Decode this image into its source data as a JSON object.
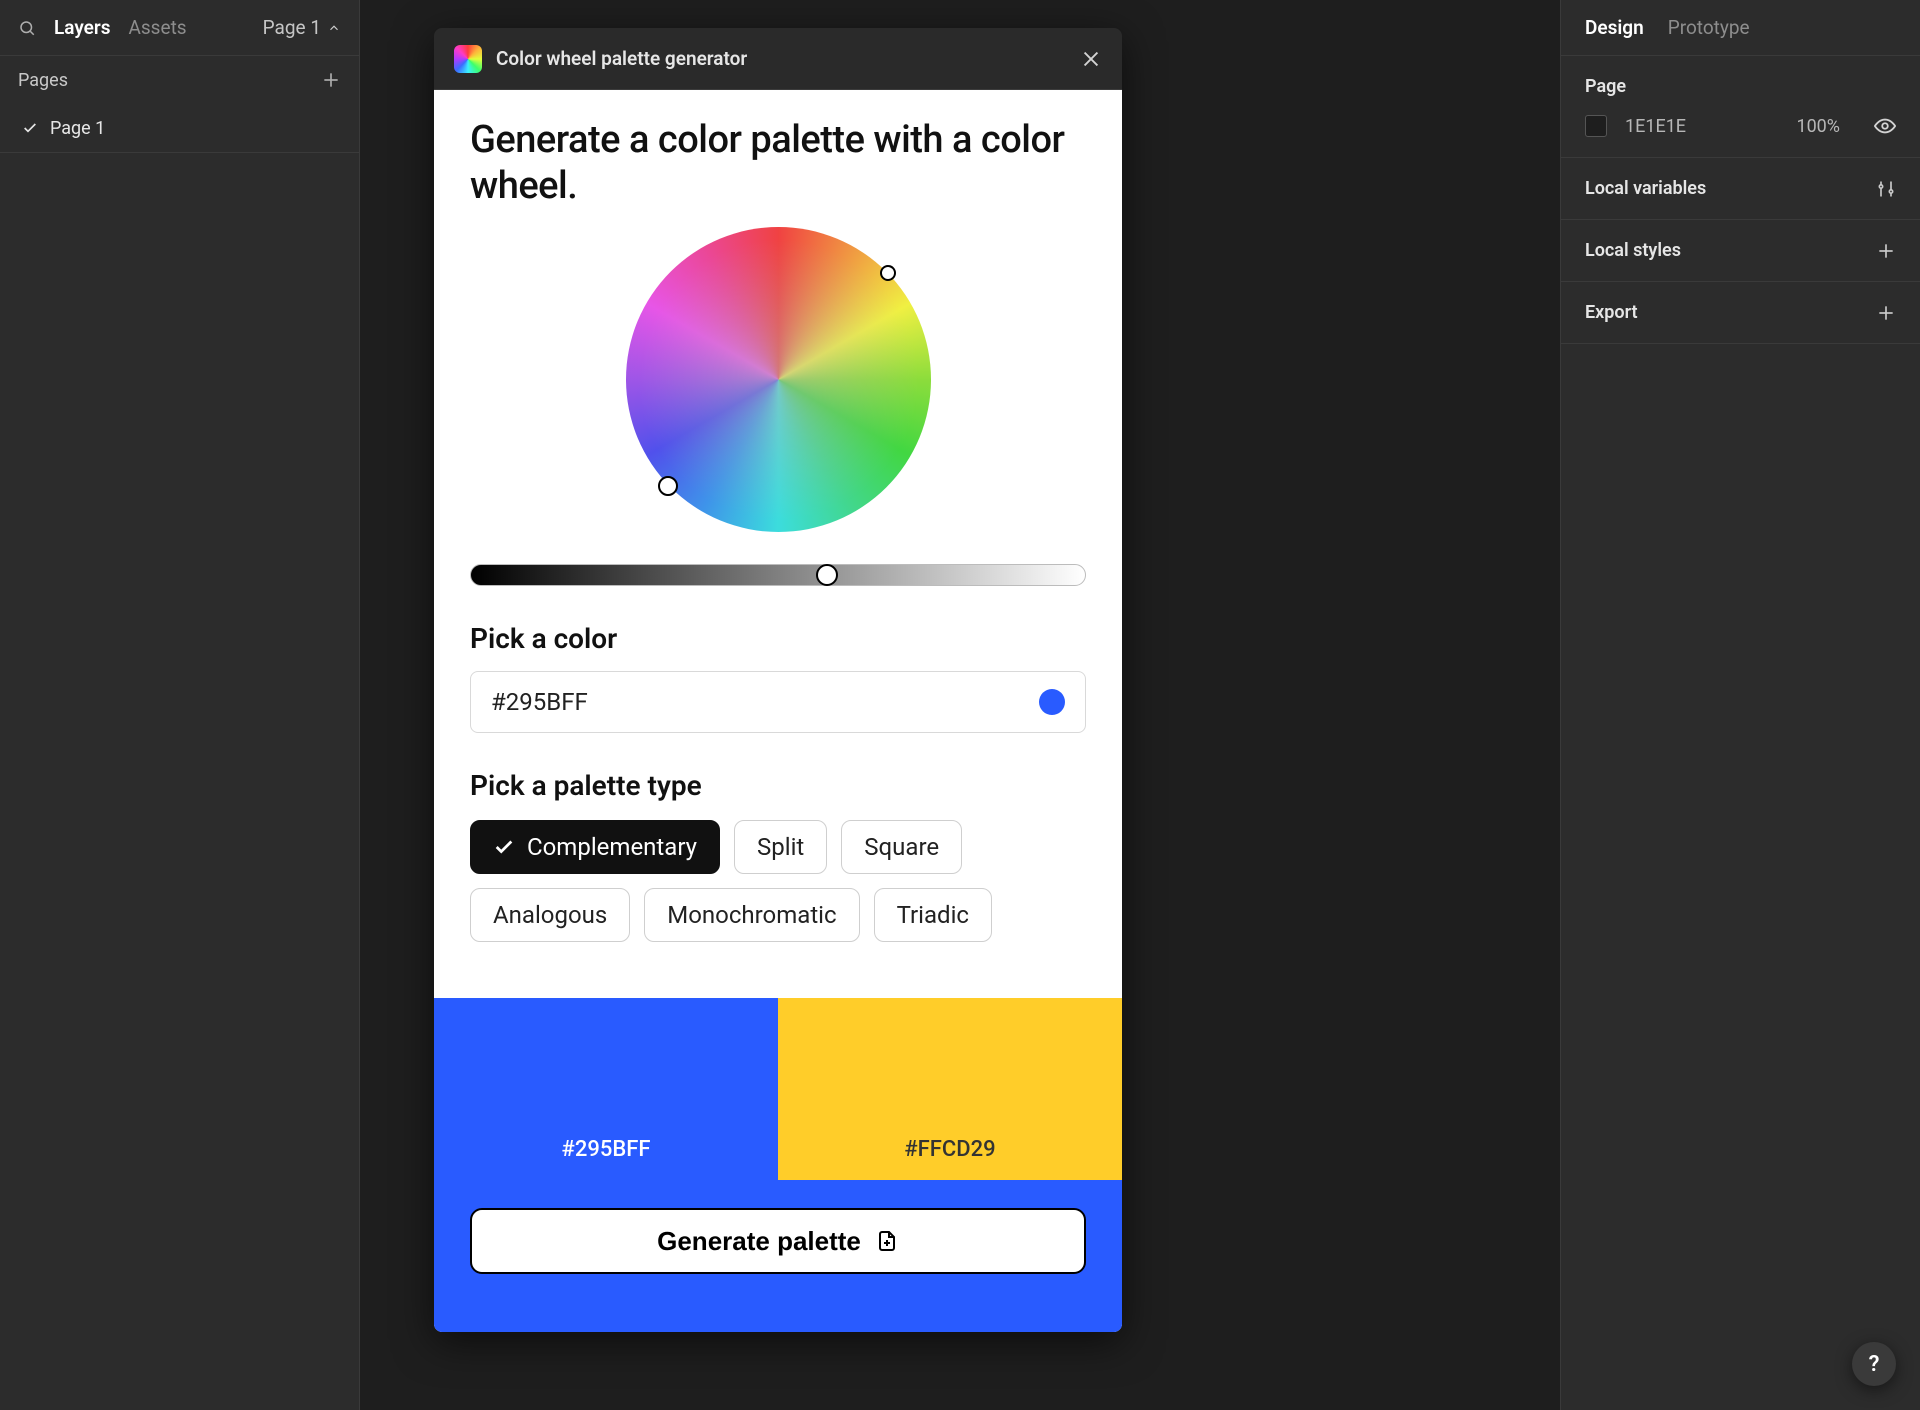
{
  "left": {
    "tabs": {
      "layers": "Layers",
      "assets": "Assets"
    },
    "page_selector": "Page 1",
    "pages_label": "Pages",
    "pages": [
      {
        "name": "Page 1",
        "active": true
      }
    ]
  },
  "right": {
    "tabs": {
      "design": "Design",
      "prototype": "Prototype"
    },
    "page_section_title": "Page",
    "page_bg_hex": "1E1E1E",
    "page_bg_opacity": "100%",
    "local_variables": "Local variables",
    "local_styles": "Local styles",
    "export": "Export"
  },
  "plugin": {
    "title": "Color wheel palette generator",
    "headline": "Generate a color palette with a color wheel.",
    "pick_color_label": "Pick a color",
    "color_hex": "#295BFF",
    "pick_palette_label": "Pick a palette type",
    "palette_types": [
      "Complementary",
      "Split",
      "Square",
      "Analogous",
      "Monochromatic",
      "Triadic"
    ],
    "selected_palette_type": "Complementary",
    "swatches": [
      {
        "hex": "#295BFF",
        "label": "#295BFF",
        "fg": "#ffffff"
      },
      {
        "hex": "#FFCD29",
        "label": "#FFCD29",
        "fg": "#333333"
      }
    ],
    "generate_label": "Generate palette",
    "bar_bg": "#295BFF"
  },
  "help_label": "?"
}
